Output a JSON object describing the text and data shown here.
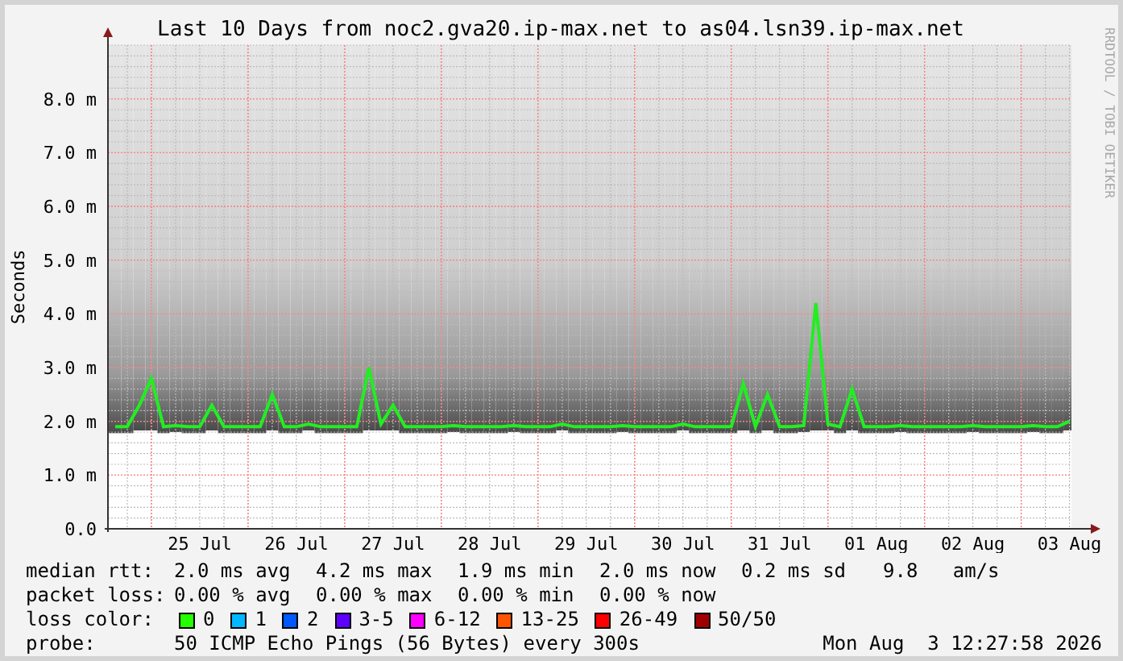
{
  "graph": {
    "chart_data": {
      "type": "line",
      "title": "Last 10 Days from noc2.gva20.ip-max.net to as04.lsn39.ip-max.net",
      "ylabel": "Seconds",
      "categories": [
        null,
        null,
        null,
        null,
        null,
        null,
        null,
        "25 Jul",
        null,
        null,
        null,
        null,
        null,
        null,
        null,
        "26 Jul",
        null,
        null,
        null,
        null,
        null,
        null,
        null,
        "27 Jul",
        null,
        null,
        null,
        null,
        null,
        null,
        null,
        "28 Jul",
        null,
        null,
        null,
        null,
        null,
        null,
        null,
        "29 Jul",
        null,
        null,
        null,
        null,
        null,
        null,
        null,
        "30 Jul",
        null,
        null,
        null,
        null,
        null,
        null,
        null,
        "31 Jul",
        null,
        null,
        null,
        null,
        null,
        null,
        null,
        "01 Aug",
        null,
        null,
        null,
        null,
        null,
        null,
        null,
        "02 Aug",
        null,
        null,
        null,
        null,
        null,
        null,
        null,
        "03 Aug"
      ],
      "series": [
        {
          "color": "#22ee22",
          "values": [
            1.9,
            1.9,
            2.3,
            2.8,
            1.9,
            1.92,
            1.9,
            1.9,
            2.3,
            1.9,
            1.9,
            1.9,
            1.9,
            2.5,
            1.9,
            1.9,
            1.95,
            1.9,
            1.9,
            1.9,
            1.9,
            3.0,
            1.95,
            2.3,
            1.9,
            1.9,
            1.9,
            1.9,
            1.92,
            1.9,
            1.9,
            1.9,
            1.9,
            1.92,
            1.9,
            1.9,
            1.9,
            1.95,
            1.9,
            1.9,
            1.9,
            1.9,
            1.92,
            1.9,
            1.9,
            1.9,
            1.9,
            1.95,
            1.9,
            1.9,
            1.9,
            1.9,
            2.7,
            1.9,
            2.5,
            1.9,
            1.9,
            1.92,
            4.2,
            1.95,
            1.9,
            2.6,
            1.9,
            1.9,
            1.9,
            1.92,
            1.9,
            1.9,
            1.9,
            1.9,
            1.9,
            1.92,
            1.9,
            1.9,
            1.9,
            1.9,
            1.92,
            1.9,
            1.9,
            2.0
          ]
        }
      ],
      "ylim": [
        0,
        9
      ],
      "grid": true,
      "yticks": [
        {
          "value": 0,
          "label": "0.0"
        },
        {
          "value": 1,
          "label": "1.0 m"
        },
        {
          "value": 2,
          "label": "2.0 m"
        },
        {
          "value": 3,
          "label": "3.0 m"
        },
        {
          "value": 4,
          "label": "4.0 m"
        },
        {
          "value": 5,
          "label": "5.0 m"
        },
        {
          "value": 6,
          "label": "6.0 m"
        },
        {
          "value": 7,
          "label": "7.0 m"
        },
        {
          "value": 8,
          "label": "8.0 m"
        }
      ]
    },
    "side_label": "RRDTOOL / TOBI OETIKER"
  },
  "legend": {
    "median_rtt": {
      "label": "median rtt:",
      "values": [
        "2.0 ms avg",
        "4.2 ms max",
        "1.9 ms min",
        "2.0 ms now",
        "0.2 ms sd",
        "9.8   am/s"
      ]
    },
    "packet_loss": {
      "label": "packet loss:",
      "values": [
        "0.00 % avg",
        "0.00 % max",
        "0.00 % min",
        "0.00 % now"
      ]
    },
    "loss_color": {
      "label": "loss color:",
      "items": [
        {
          "label": "0",
          "color": "#26ff00"
        },
        {
          "label": "1",
          "color": "#00b8ff"
        },
        {
          "label": "2",
          "color": "#0059ff"
        },
        {
          "label": "3-5",
          "color": "#5e00ff"
        },
        {
          "label": "6-12",
          "color": "#ff00ff"
        },
        {
          "label": "13-25",
          "color": "#ff5500"
        },
        {
          "label": "26-49",
          "color": "#ff0000"
        },
        {
          "label": "50/50",
          "color": "#a10000"
        }
      ]
    },
    "probe": {
      "label": "probe:",
      "text": "50 ICMP Echo Pings (56 Bytes) every 300s",
      "timestamp": "Mon Aug  3 12:27:58 2026"
    }
  }
}
